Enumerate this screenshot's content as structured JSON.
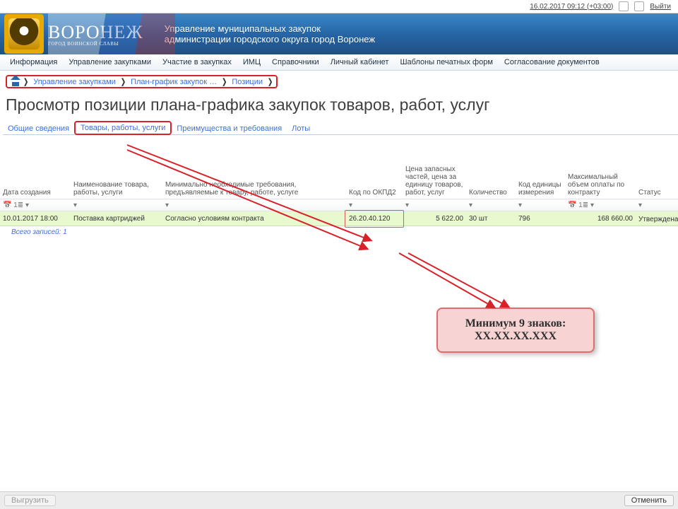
{
  "sysbar": {
    "timestamp": "16.02.2017 09:12 (+03:00)",
    "logout": "Выйти"
  },
  "banner": {
    "city": "ВОРОНЕЖ",
    "slogan": "ГОРОД ВОИНСКОЙ СЛАВЫ",
    "title_l1": "Управление муниципальных закупок",
    "title_l2": "администрации городского округа город Воронеж"
  },
  "menu": [
    "Информация",
    "Управление закупками",
    "Участие в закупках",
    "ИМЦ",
    "Справочники",
    "Личный кабинет",
    "Шаблоны печатных форм",
    "Согласование документов"
  ],
  "breadcrumb": [
    "Управление закупками",
    "План-график закупок …",
    "Позиции"
  ],
  "page_title": "Просмотр позиции плана-графика закупок товаров, работ, услуг",
  "tabs": [
    "Общие сведения",
    "Товары, работы, услуги",
    "Преимущества и требования",
    "Лоты"
  ],
  "columns": [
    "Дата создания",
    "Наименование товара, работы, услуги",
    "Минимально необходимые требования, предъявляемые к товару, работе, услуге",
    "Код по ОКПД2",
    "Цена запасных частей, цена за единицу товаров, работ, услуг",
    "Количество",
    "Код единицы измерения",
    "Максимальный объем оплаты по контракту",
    "Статус"
  ],
  "row": {
    "date": "10.01.2017 18:00",
    "name": "Поставка картриджей",
    "req": "Согласно условиям контракта",
    "code": "26.20.40.120",
    "price": "5 622.00",
    "qty": "30 шт",
    "uom": "796",
    "max": "168 660.00",
    "status": "Утверждена"
  },
  "footer_total": "Всего записей: 1",
  "callout": {
    "l1": "Минимум 9 знаков:",
    "l2": "ХХ.ХХ.ХХ.ХХХ"
  },
  "bottom": {
    "export": "Выгрузить",
    "cancel": "Отменить"
  }
}
